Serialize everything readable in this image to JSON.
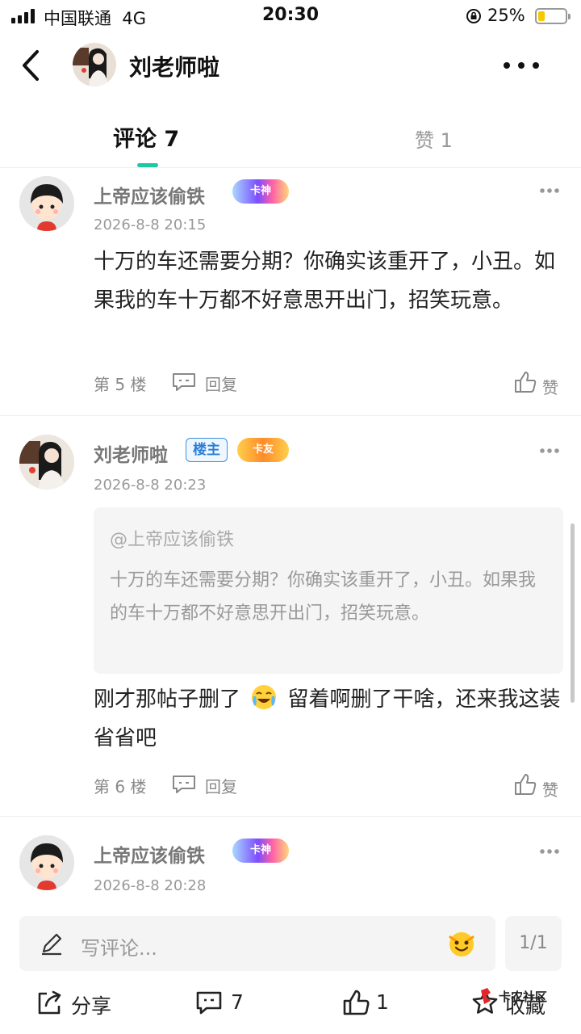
{
  "status_bar": {
    "carrier": "中国联通",
    "network": "4G",
    "time": "20:30",
    "battery_percent": "25%",
    "battery_level": 0.25
  },
  "header": {
    "title": "刘老师啦"
  },
  "tabs": [
    {
      "label": "评论 7",
      "active": true
    },
    {
      "label": "赞 1",
      "active": false
    }
  ],
  "comments": [
    {
      "username": "上帝应该偷铁",
      "badge": "卡神",
      "time": "2026-8-8 20:15",
      "text": "十万的车还需要分期？你确实该重开了，小丑。如果我的车十万都不好意思开出门，招笑玩意。",
      "floor": "第 5 楼",
      "reply_label": "回复",
      "like_label": "赞"
    },
    {
      "username": "刘老师啦",
      "owner_badge": "楼主",
      "badge": "卡友",
      "time": "2026-8-8 20:23",
      "quote_user": "@上帝应该偷铁",
      "quote_text": "十万的车还需要分期？你确实该重开了，小丑。如果我的车十万都不好意思开出门，招笑玩意。",
      "text_before_emoji": "刚才那帖子删了",
      "text_after_emoji": "留着啊删了干啥，还来我这装省省吧",
      "floor": "第 6 楼",
      "reply_label": "回复",
      "like_label": "赞"
    },
    {
      "username": "上帝应该偷铁",
      "badge": "卡神",
      "time": "2026-8-8 20:28"
    }
  ],
  "input": {
    "placeholder": "写评论...",
    "page": "1/1"
  },
  "bottom_bar": {
    "share_label": "分享",
    "comment_count": "7",
    "like_count": "1",
    "favorite_label": "收藏"
  },
  "watermark": "卡农社区",
  "colors": {
    "accent": "#1ec8a5",
    "owner_badge": "#2c7fd6"
  },
  "icons": [
    "back-icon",
    "more-icon",
    "reply-icon",
    "like-icon",
    "pen-icon",
    "emoji-icon",
    "share-icon",
    "comment-icon",
    "star-icon"
  ]
}
